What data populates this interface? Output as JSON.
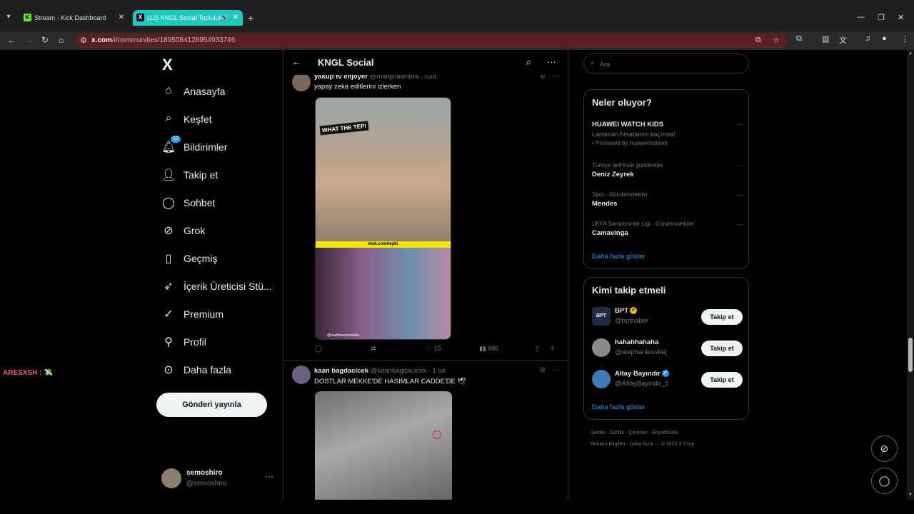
{
  "browser": {
    "tabs": [
      {
        "title": "Stream - Kick Dashboard",
        "favicon": "K"
      },
      {
        "title": "(12) KNGL Social Topluluk",
        "favicon": "X"
      }
    ],
    "url_host": "x.com",
    "url_path": "/i/communities/1895084128954933746"
  },
  "sidebar": {
    "logo": "X",
    "items": [
      {
        "label": "Anasayfa",
        "icon": "home-icon"
      },
      {
        "label": "Keşfet",
        "icon": "search-icon"
      },
      {
        "label": "Bildirimler",
        "icon": "bell-icon",
        "badge": "12"
      },
      {
        "label": "Takip et",
        "icon": "add-person-icon"
      },
      {
        "label": "Sohbet",
        "icon": "chat-icon"
      },
      {
        "label": "Grok",
        "icon": "grok-icon"
      },
      {
        "label": "Geçmiş",
        "icon": "bookmark-icon"
      },
      {
        "label": "İçerik Üreticisi Stü...",
        "icon": "rocket-icon"
      },
      {
        "label": "Premium",
        "icon": "verified-icon"
      },
      {
        "label": "Profil",
        "icon": "person-icon"
      },
      {
        "label": "Daha fazla",
        "icon": "more-circle-icon"
      }
    ],
    "post_button": "Gönderi yayınla",
    "profile": {
      "name": "semoshiro",
      "handle": "@semoshiro"
    }
  },
  "overlay": {
    "chat_user": "ARESXSH :"
  },
  "main": {
    "title": "KNGL Social",
    "tweets": [
      {
        "name": "yakup tv enjoyer",
        "handle": "@manjinalimbra",
        "time": "53d",
        "text": "yapay zeka editlerini izlerken",
        "media_logo": "WHAT THE TEP!",
        "media_bar": "kick.com/tepki",
        "media_footer": "@hustleworksmedia",
        "stats": {
          "replies": "",
          "reposts": "",
          "likes": "15",
          "views": "886"
        }
      },
      {
        "name": "kaan bagdacicek",
        "handle": "@kaanbagdacicek",
        "time": "1 sa",
        "text": "DOSTLAR MEKKE'DE HASIMLAR CADDE'DE 🕊"
      }
    ]
  },
  "right": {
    "search_placeholder": "Ara",
    "trends_title": "Neler oluyor?",
    "trends": [
      {
        "context": "",
        "name": "HUAWEI WATCH KIDS",
        "sub": "Lansman fırsatlarını kaçırma!",
        "promo": "Promoted by huaweimobiletr"
      },
      {
        "context": "Türkiye tarihinde gündemde",
        "name": "Deniz Zeyrek"
      },
      {
        "context": "Spor · Gündemdekiler",
        "name": "Mendes"
      },
      {
        "context": "UEFA Şampiyonlar Ligi · Gündemdekiler",
        "name": "Camavinga"
      }
    ],
    "show_more": "Daha fazla göster",
    "who_title": "Kimi takip etmeli",
    "who": [
      {
        "name": "BPT",
        "handle": "@bpthaber",
        "badge_color": "#e2b719",
        "avatar_text": "BPT"
      },
      {
        "name": "hahahhahaha",
        "handle": "@stephaniesvkej",
        "badge_color": "",
        "avatar_text": ""
      },
      {
        "name": "Altay Bayındır",
        "handle": "@AltayBayindir_1",
        "badge_color": "#1d9bf0",
        "avatar_text": ""
      }
    ],
    "follow_label": "Takip et",
    "footer_line1": "Şartlar  ·  Gizlilik  ·  Çerezler  ·  Erişilebilirlik  ·",
    "footer_line2": "Reklam Bilgileri  ·  Daha fazla ···    © 2026 X Corp."
  },
  "colors": {
    "accent": "#1d9bf0",
    "tab_active": "#1ec8c0",
    "omnibox": "#5b1f1f"
  }
}
